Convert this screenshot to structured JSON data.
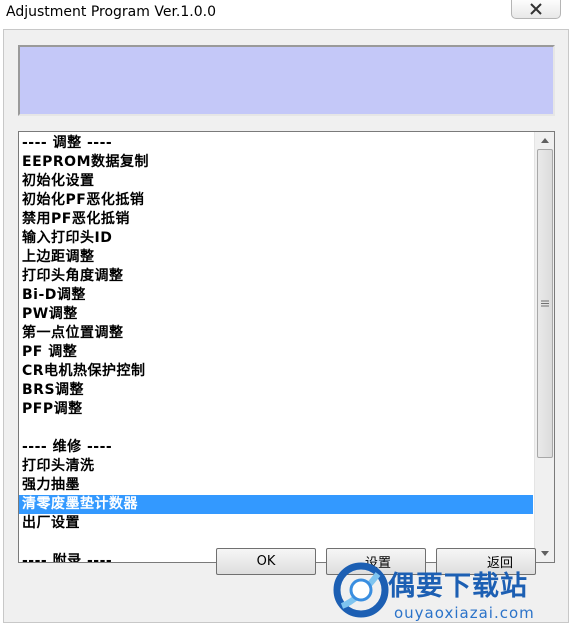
{
  "window": {
    "title": "Adjustment Program Ver.1.0.0"
  },
  "message": "",
  "list": {
    "items": [
      {
        "label": "---- 调整 ----",
        "selected": false
      },
      {
        "label": "EEPROM数据复制",
        "selected": false
      },
      {
        "label": "初始化设置",
        "selected": false
      },
      {
        "label": "初始化PF恶化抵销",
        "selected": false
      },
      {
        "label": "禁用PF恶化抵销",
        "selected": false
      },
      {
        "label": "输入打印头ID",
        "selected": false
      },
      {
        "label": "上边距调整",
        "selected": false
      },
      {
        "label": "打印头角度调整",
        "selected": false
      },
      {
        "label": "Bi-D调整",
        "selected": false
      },
      {
        "label": "PW调整",
        "selected": false
      },
      {
        "label": "第一点位置调整",
        "selected": false
      },
      {
        "label": "PF 调整",
        "selected": false
      },
      {
        "label": "CR电机热保护控制",
        "selected": false
      },
      {
        "label": "BRS调整",
        "selected": false
      },
      {
        "label": "PFP调整",
        "selected": false
      },
      {
        "label": "",
        "selected": false
      },
      {
        "label": "---- 维修 ----",
        "selected": false
      },
      {
        "label": "打印头清洗",
        "selected": false
      },
      {
        "label": "强力抽墨",
        "selected": false
      },
      {
        "label": "清零废墨垫计数器",
        "selected": true
      },
      {
        "label": "出厂设置",
        "selected": false
      },
      {
        "label": "",
        "selected": false
      },
      {
        "label": "---- 附录 ----",
        "selected": false
      }
    ],
    "scroll_fraction_visible": 0.78
  },
  "buttons": {
    "ok": "OK",
    "setting": "设置",
    "back": "返回"
  },
  "watermark": {
    "title": "偶要下载站",
    "url": "ouyaoxiazai.com"
  },
  "colors": {
    "message_bg": "#c4c8f8",
    "selection": "#3399ff",
    "watermark": "#1c5fb3"
  }
}
